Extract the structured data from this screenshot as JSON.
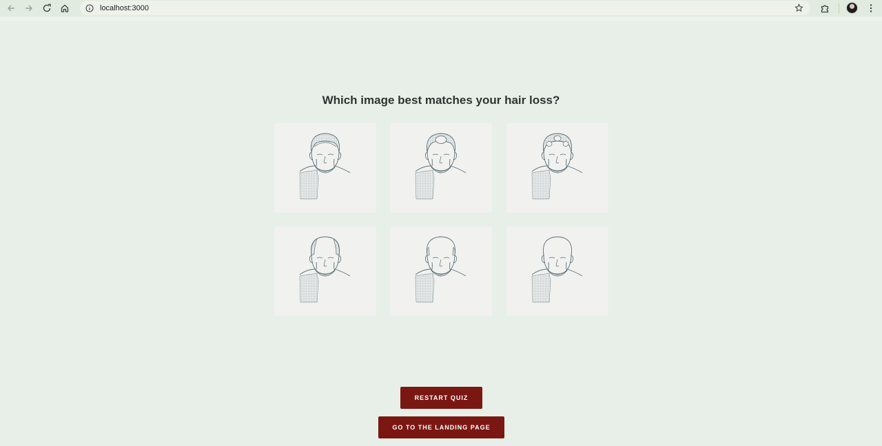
{
  "browser": {
    "url": "localhost:3000",
    "icons": [
      "back-icon",
      "forward-icon",
      "reload-icon",
      "home-icon",
      "info-icon",
      "star-icon",
      "extensions-icon",
      "menu-icon"
    ]
  },
  "quiz": {
    "question": "Which image best matches your hair loss?",
    "options": [
      {
        "name": "full-hair",
        "selected": false
      },
      {
        "name": "crown-spot",
        "selected": false
      },
      {
        "name": "patchy-spots",
        "selected": false
      },
      {
        "name": "top-thinning",
        "selected": false
      },
      {
        "name": "side-fringe",
        "selected": false
      },
      {
        "name": "bald",
        "selected": false
      }
    ]
  },
  "actions": {
    "restart_label": "RESTART QUIZ",
    "landing_label": "GO TO THE LANDING PAGE"
  },
  "colors": {
    "page_bg": "#e8efe8",
    "button_bg": "#7a1712",
    "card_bg": "#f1f1f0",
    "line": "#5b6f73"
  }
}
